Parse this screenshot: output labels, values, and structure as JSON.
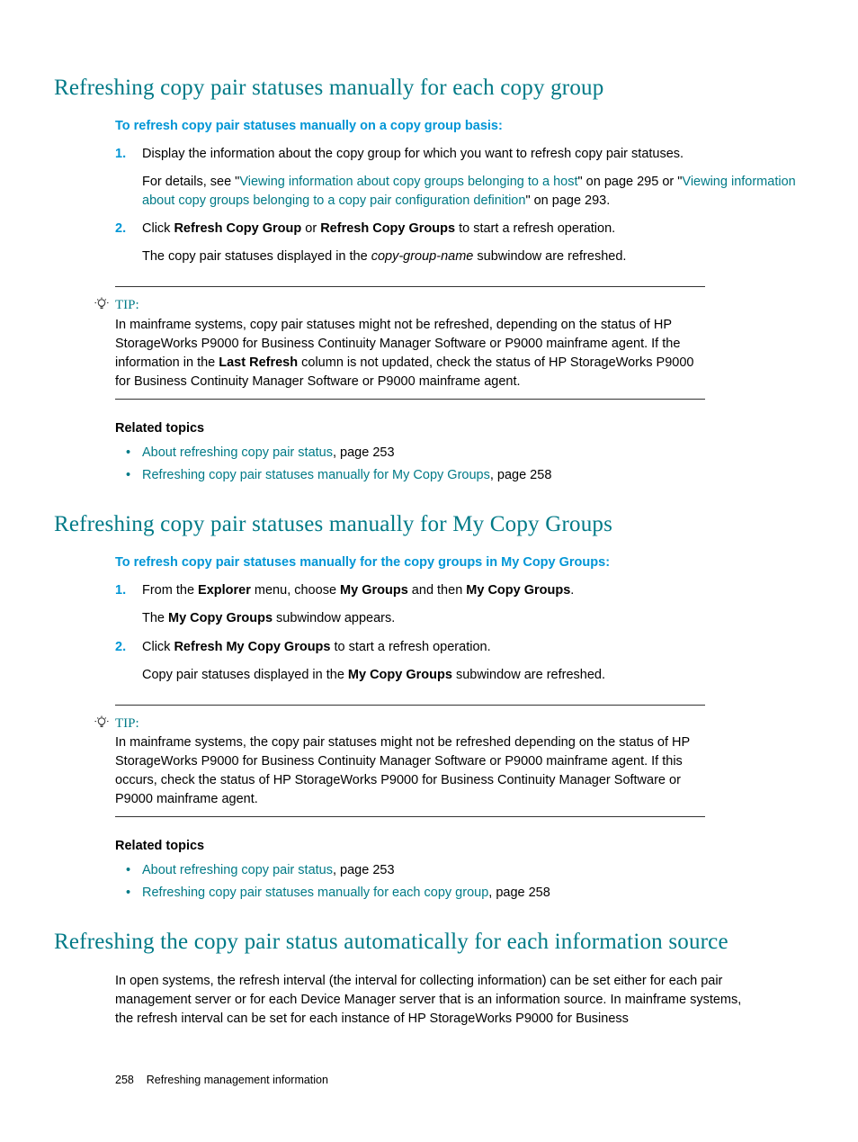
{
  "section1": {
    "heading": "Refreshing copy pair statuses manually for each copy group",
    "instruction": "To refresh copy pair statuses manually on a copy group basis:",
    "step1": {
      "num": "1.",
      "p1": "Display the information about the copy group for which you want to refresh copy pair statuses.",
      "p2_a": "For details, see \"",
      "p2_link1": "Viewing information about copy groups belonging to a host",
      "p2_b": "\" on page 295 or \"",
      "p2_link2": "Viewing information about copy groups belonging to a copy pair configuration definition",
      "p2_c": "\" on page 293."
    },
    "step2": {
      "num": "2.",
      "p1_a": "Click ",
      "p1_b1": "Refresh Copy Group",
      "p1_c": " or ",
      "p1_b2": "Refresh Copy Groups",
      "p1_d": " to start a refresh operation.",
      "p2_a": "The copy pair statuses displayed in the ",
      "p2_i": "copy-group-name",
      "p2_b": " subwindow are refreshed."
    },
    "tip": {
      "label": "TIP:",
      "body_a": "In mainframe systems, copy pair statuses might not be refreshed, depending on the status of HP StorageWorks P9000 for Business Continuity Manager Software or P9000 mainframe agent. If the information in the ",
      "body_bold": "Last Refresh",
      "body_b": " column is not updated, check the status of HP StorageWorks P9000 for Business Continuity Manager Software or P9000 mainframe agent."
    },
    "related_heading": "Related topics",
    "related1_link": "About refreshing copy pair status",
    "related1_tail": ", page 253",
    "related2_link": "Refreshing copy pair statuses manually for My Copy Groups",
    "related2_tail": ", page 258"
  },
  "section2": {
    "heading": "Refreshing copy pair statuses manually for My Copy Groups",
    "instruction": "To refresh copy pair statuses manually for the copy groups in My Copy Groups:",
    "step1": {
      "num": "1.",
      "p1_a": "From the ",
      "p1_b1": "Explorer",
      "p1_b": " menu, choose ",
      "p1_b2": "My Groups",
      "p1_c": " and then ",
      "p1_b3": "My Copy Groups",
      "p1_d": ".",
      "p2_a": "The ",
      "p2_b1": "My Copy Groups",
      "p2_b": " subwindow appears."
    },
    "step2": {
      "num": "2.",
      "p1_a": "Click ",
      "p1_b1": "Refresh My Copy Groups",
      "p1_b": " to start a refresh operation.",
      "p2_a": "Copy pair statuses displayed in the ",
      "p2_b1": "My Copy Groups",
      "p2_b": " subwindow are refreshed."
    },
    "tip": {
      "label": "TIP:",
      "body": "In mainframe systems, the copy pair statuses might not be refreshed depending on the status of HP StorageWorks P9000 for Business Continuity Manager Software or P9000 mainframe agent. If this occurs, check the status of HP StorageWorks P9000 for Business Continuity Manager Software or P9000 mainframe agent."
    },
    "related_heading": "Related topics",
    "related1_link": "About refreshing copy pair status",
    "related1_tail": ", page 253",
    "related2_link": "Refreshing copy pair statuses manually for each copy group",
    "related2_tail": ", page 258"
  },
  "section3": {
    "heading": "Refreshing the copy pair status automatically for each information source",
    "body": "In open systems, the refresh interval (the interval for collecting information) can be set either for each pair management server or for each Device Manager server that is an information source. In mainframe systems, the refresh interval can be set for each instance of HP StorageWorks P9000 for Business"
  },
  "footer": {
    "page": "258",
    "title": "Refreshing management information"
  }
}
